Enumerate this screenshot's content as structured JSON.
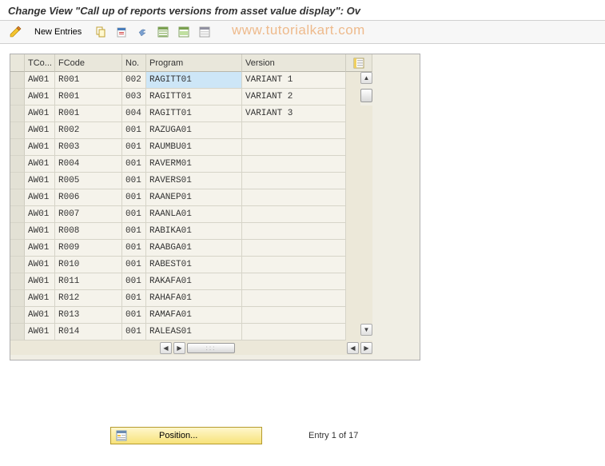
{
  "title": "Change View \"Call up of reports versions from asset value display\": Ov",
  "toolbar": {
    "new_entries_label": "New Entries"
  },
  "watermark": "www.tutorialkart.com",
  "table": {
    "headers": {
      "tcode": "TCo...",
      "fcode": "FCode",
      "no": "No.",
      "program": "Program",
      "version": "Version"
    },
    "rows": [
      {
        "tcode": "AW01",
        "fcode": "R001",
        "no": "002",
        "program": "RAGITT01",
        "version": "VARIANT 1",
        "sel": true
      },
      {
        "tcode": "AW01",
        "fcode": "R001",
        "no": "003",
        "program": "RAGITT01",
        "version": "VARIANT 2",
        "sel": false
      },
      {
        "tcode": "AW01",
        "fcode": "R001",
        "no": "004",
        "program": "RAGITT01",
        "version": "VARIANT 3",
        "sel": false
      },
      {
        "tcode": "AW01",
        "fcode": "R002",
        "no": "001",
        "program": "RAZUGA01",
        "version": "",
        "sel": false
      },
      {
        "tcode": "AW01",
        "fcode": "R003",
        "no": "001",
        "program": "RAUMBU01",
        "version": "",
        "sel": false
      },
      {
        "tcode": "AW01",
        "fcode": "R004",
        "no": "001",
        "program": "RAVERM01",
        "version": "",
        "sel": false
      },
      {
        "tcode": "AW01",
        "fcode": "R005",
        "no": "001",
        "program": "RAVERS01",
        "version": "",
        "sel": false
      },
      {
        "tcode": "AW01",
        "fcode": "R006",
        "no": "001",
        "program": "RAANEP01",
        "version": "",
        "sel": false
      },
      {
        "tcode": "AW01",
        "fcode": "R007",
        "no": "001",
        "program": "RAANLA01",
        "version": "",
        "sel": false
      },
      {
        "tcode": "AW01",
        "fcode": "R008",
        "no": "001",
        "program": "RABIKA01",
        "version": "",
        "sel": false
      },
      {
        "tcode": "AW01",
        "fcode": "R009",
        "no": "001",
        "program": "RAABGA01",
        "version": "",
        "sel": false
      },
      {
        "tcode": "AW01",
        "fcode": "R010",
        "no": "001",
        "program": "RABEST01",
        "version": "",
        "sel": false
      },
      {
        "tcode": "AW01",
        "fcode": "R011",
        "no": "001",
        "program": "RAKAFA01",
        "version": "",
        "sel": false
      },
      {
        "tcode": "AW01",
        "fcode": "R012",
        "no": "001",
        "program": "RAHAFA01",
        "version": "",
        "sel": false
      },
      {
        "tcode": "AW01",
        "fcode": "R013",
        "no": "001",
        "program": "RAMAFA01",
        "version": "",
        "sel": false
      },
      {
        "tcode": "AW01",
        "fcode": "R014",
        "no": "001",
        "program": "RALEAS01",
        "version": "",
        "sel": false
      }
    ]
  },
  "footer": {
    "position_label": "Position...",
    "entry_text": "Entry 1 of 17"
  }
}
